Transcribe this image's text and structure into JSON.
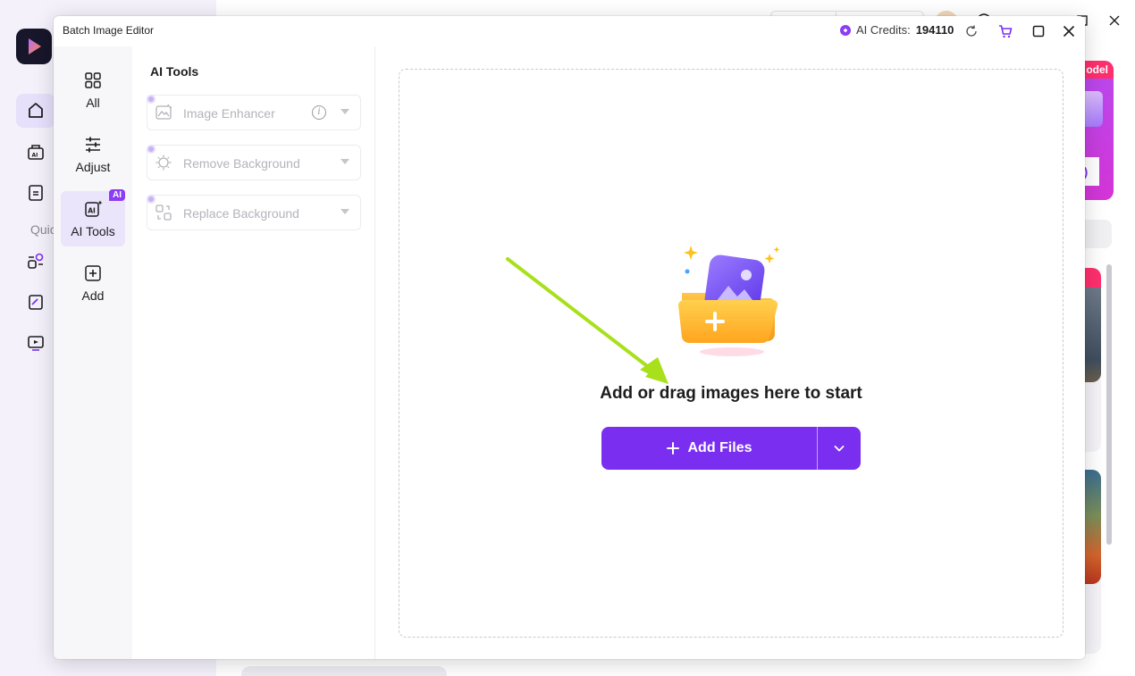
{
  "dialog": {
    "title": "Batch Image Editor",
    "credits_label": "AI Credits:",
    "credits_value": "194110"
  },
  "rail": {
    "items": [
      {
        "label": "All"
      },
      {
        "label": "Adjust"
      },
      {
        "label": "AI Tools",
        "badge": "AI"
      },
      {
        "label": "Add"
      }
    ]
  },
  "tools": {
    "heading": "AI Tools",
    "items": [
      {
        "label": "Image Enhancer"
      },
      {
        "label": "Remove Background"
      },
      {
        "label": "Replace Background"
      }
    ]
  },
  "dropzone": {
    "prompt": "Add or drag images here to start",
    "add_button": "Add Files"
  },
  "background": {
    "quick_label": "Quic",
    "promo_tag": "odel",
    "promo_button": ")"
  },
  "colors": {
    "accent": "#7a2ff0",
    "arrow": "#a8e01b"
  }
}
